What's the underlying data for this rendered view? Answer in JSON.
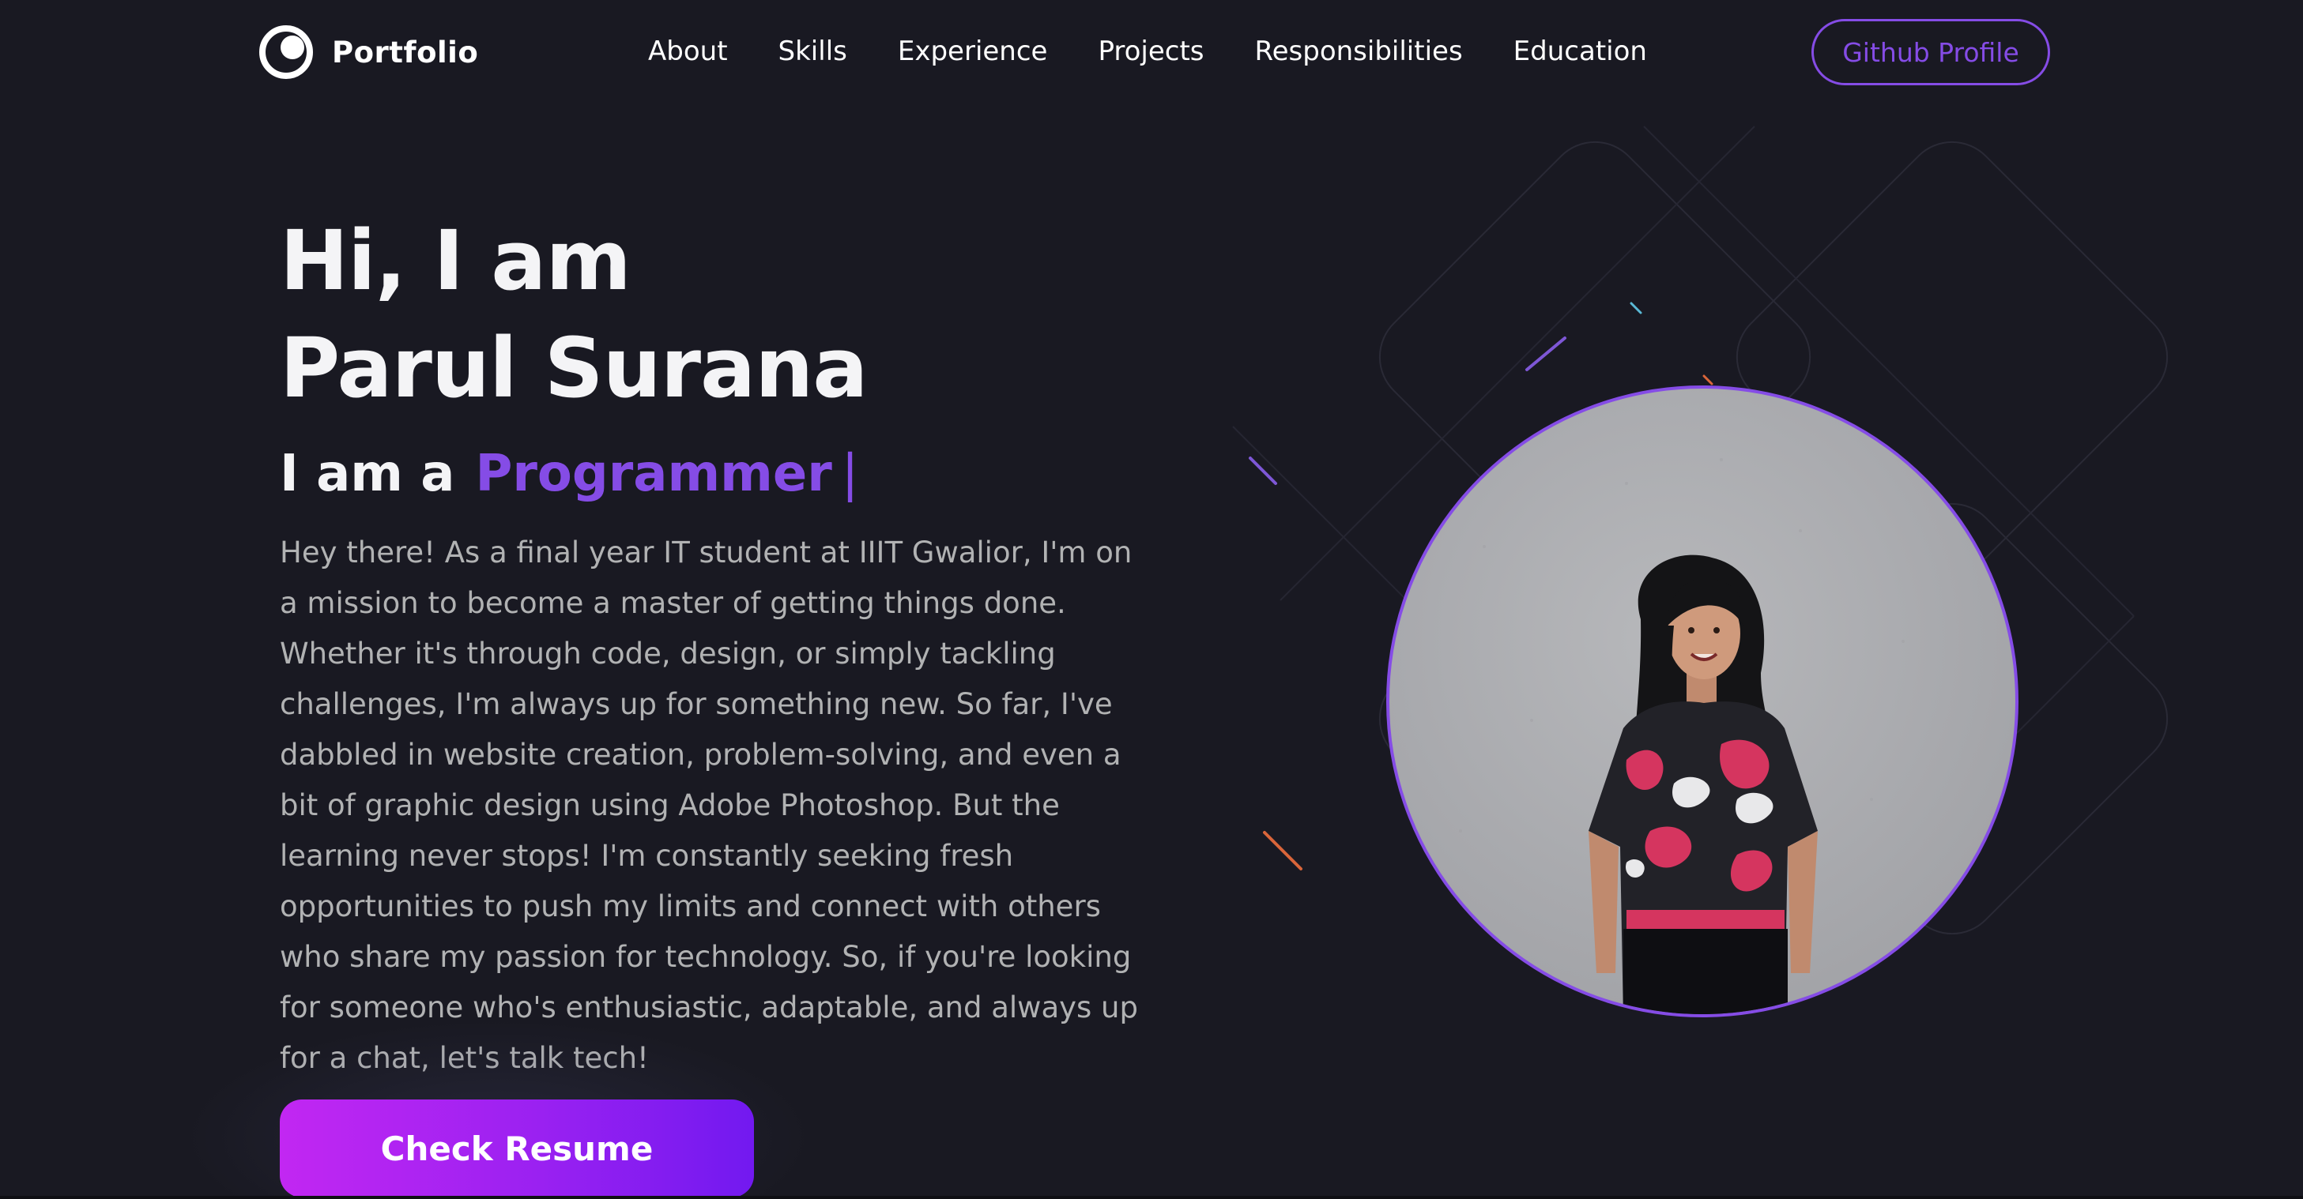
{
  "brand": {
    "name": "Portfolio",
    "icon": "portfolio-logo-icon"
  },
  "nav": {
    "links": [
      "About",
      "Skills",
      "Experience",
      "Projects",
      "Responsibilities",
      "Education"
    ],
    "github_label": "Github Profile"
  },
  "hero": {
    "greeting": "Hi, I am",
    "name": "Parul Surana",
    "role_prefix": "I am a",
    "role_word": "Programmer",
    "role_cursor": "|",
    "bio": "Hey there! As a final year IT student at IIIT Gwalior, I'm on a mission to become a master of getting things done. Whether it's through code, design, or simply tackling challenges, I'm always up for something new. So far, I've dabbled in website creation, problem-solving, and even a bit of graphic design using Adobe Photoshop. But the learning never stops! I'm constantly seeking fresh opportunities to push my limits and connect with others who share my passion for technology. So, if you're looking for someone who's enthusiastic, adaptable, and always up for a chat, let's talk tech!",
    "resume_label": "Check Resume",
    "profile_image": "profile-photo"
  },
  "colors": {
    "background": "#191922",
    "accent": "#854ce6",
    "text_primary": "#f4f4f6",
    "text_secondary": "#b1b2b3",
    "button_gradient_start": "#c227f2",
    "button_gradient_end": "#7219f0"
  }
}
